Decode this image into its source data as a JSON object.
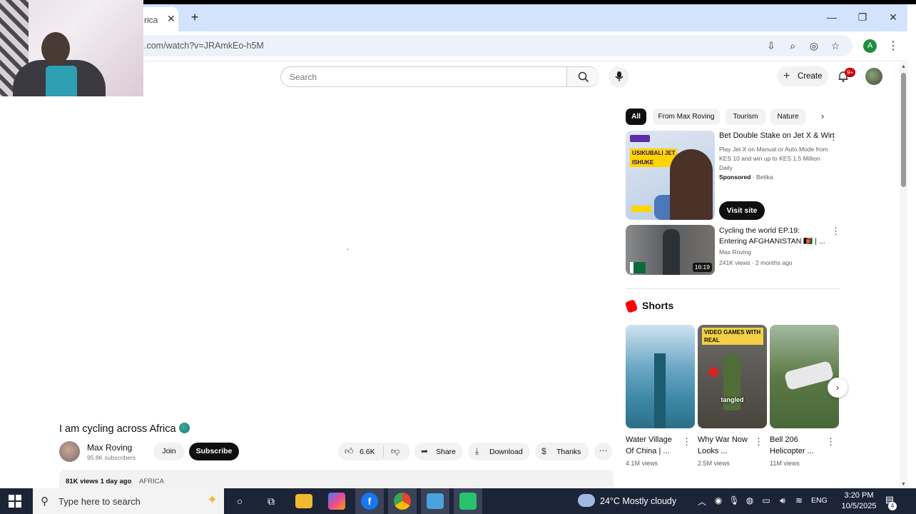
{
  "browser": {
    "tab_title": "rica",
    "tab_close": "✕",
    "new_tab": "+",
    "url": ".com/watch?v=JRAmkEo-h5M",
    "window_controls": {
      "minimize": "—",
      "maximize": "❐",
      "close": "✕"
    },
    "profile_initial": "A"
  },
  "header": {
    "search_placeholder": "Search",
    "create_label": "Create",
    "notification_badge": "9+"
  },
  "video": {
    "title": "I am cycling across Africa",
    "channel_name": "Max Roving",
    "subscribers": "95.8K subscribers",
    "join_label": "Join",
    "subscribe_label": "Subscribe",
    "likes": "6.6K",
    "share_label": "Share",
    "download_label": "Download",
    "thanks_label": "Thanks",
    "views": "81K views  1 day ago",
    "tag": "AFRICA"
  },
  "chips": [
    {
      "label": "All",
      "active": true
    },
    {
      "label": "From Max Roving",
      "active": false
    },
    {
      "label": "Tourism",
      "active": false
    },
    {
      "label": "Nature",
      "active": false
    }
  ],
  "ad": {
    "title": "Bet Double Stake on Jet X & Win",
    "description": "Play Jet X on Manual or Auto Mode from KES 10 and win up to KES 1.5 Million Daily",
    "sponsored_label": "Sponsored",
    "advertiser": " · Betika",
    "visit_label": "Visit site",
    "thumb_tag": "USIKUBALI JET ISHUKE"
  },
  "recommendation": {
    "title": "Cycling the world EP.19: Entering AFGHANISTAN 🇦🇫 | ...",
    "channel": "Max Roving",
    "meta": "241K views · 2 months ago",
    "duration": "16:19"
  },
  "shorts": {
    "heading": "Shorts",
    "items": [
      {
        "title": "Water Village Of China | ...",
        "views": "4.1M views"
      },
      {
        "title": "Why War Now Looks ...",
        "views": "2.5M views",
        "overlay_banner": "VIDEO GAMES WITH REAL",
        "overlay_label": "tangled"
      },
      {
        "title": "Bell 206 Helicopter ...",
        "views": "11M views"
      }
    ]
  },
  "taskbar": {
    "search_placeholder": "Type here to search",
    "weather": "24°C  Mostly cloudy",
    "language": "ENG",
    "time": "3:20 PM",
    "date": "10/5/2025",
    "notification_count": "4"
  }
}
